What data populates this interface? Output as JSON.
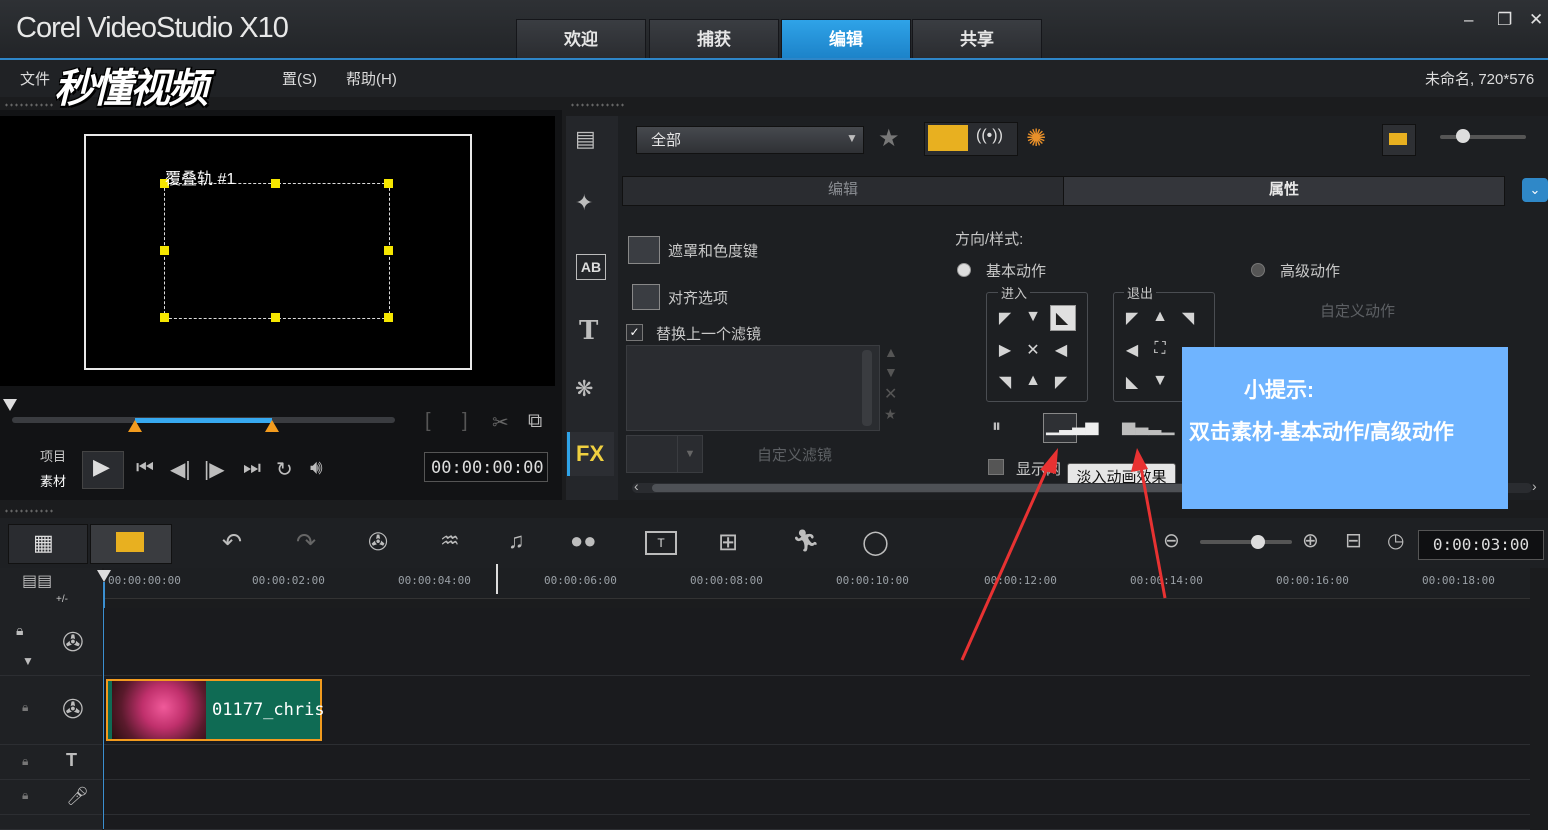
{
  "app": {
    "title": "Corel VideoStudio X10",
    "project": "未命名, 720*576"
  },
  "tabs": [
    {
      "label": "欢迎"
    },
    {
      "label": "捕获"
    },
    {
      "label": "编辑"
    },
    {
      "label": "共享"
    }
  ],
  "window": {
    "minimize": "‒",
    "restore": "❐",
    "close": "✕"
  },
  "menu": {
    "file": "文件",
    "settings_tail": "置(S)",
    "help": "帮助(H)"
  },
  "watermark": "秒懂视频",
  "preview": {
    "overlay_label": "覆叠轨 #1",
    "project_label": "项目",
    "clip_label": "素材",
    "timecode": "00:00:00:00"
  },
  "library": {
    "category": "全部"
  },
  "subtabs": {
    "edit": "编辑",
    "attributes": "属性"
  },
  "attributes": {
    "mask_chroma": "遮罩和色度键",
    "align_options": "对齐选项",
    "replace_filter": "替换上一个滤镜",
    "custom_filter": "自定义滤镜",
    "direction_style": "方向/样式:",
    "basic_motion": "基本动作",
    "advanced_motion": "高级动作",
    "enter": "进入",
    "exit": "退出",
    "custom_motion": "自定义动作",
    "show_grid": "显示网"
  },
  "tooltip": "淡入动画效果",
  "tip": {
    "title": "小提示:",
    "text": "双击素材-基本动作/高级动作"
  },
  "timeline": {
    "time": "0:00:03:00",
    "ticks": [
      "00:00:00:00",
      "00:00:02:00",
      "00:00:04:00",
      "00:00:06:00",
      "00:00:08:00",
      "00:00:10:00",
      "00:00:12:00",
      "00:00:14:00",
      "00:00:16:00",
      "00:00:18:00"
    ],
    "clip_name": "01177_chris",
    "plusminus": "+/-"
  },
  "colors": {
    "accent": "#2fa3e8",
    "tip": "#6fb4ff",
    "clip": "#0f6b54",
    "clip_border": "#f29b1e",
    "arrow": "#e83232",
    "handle": "#f5e600"
  }
}
